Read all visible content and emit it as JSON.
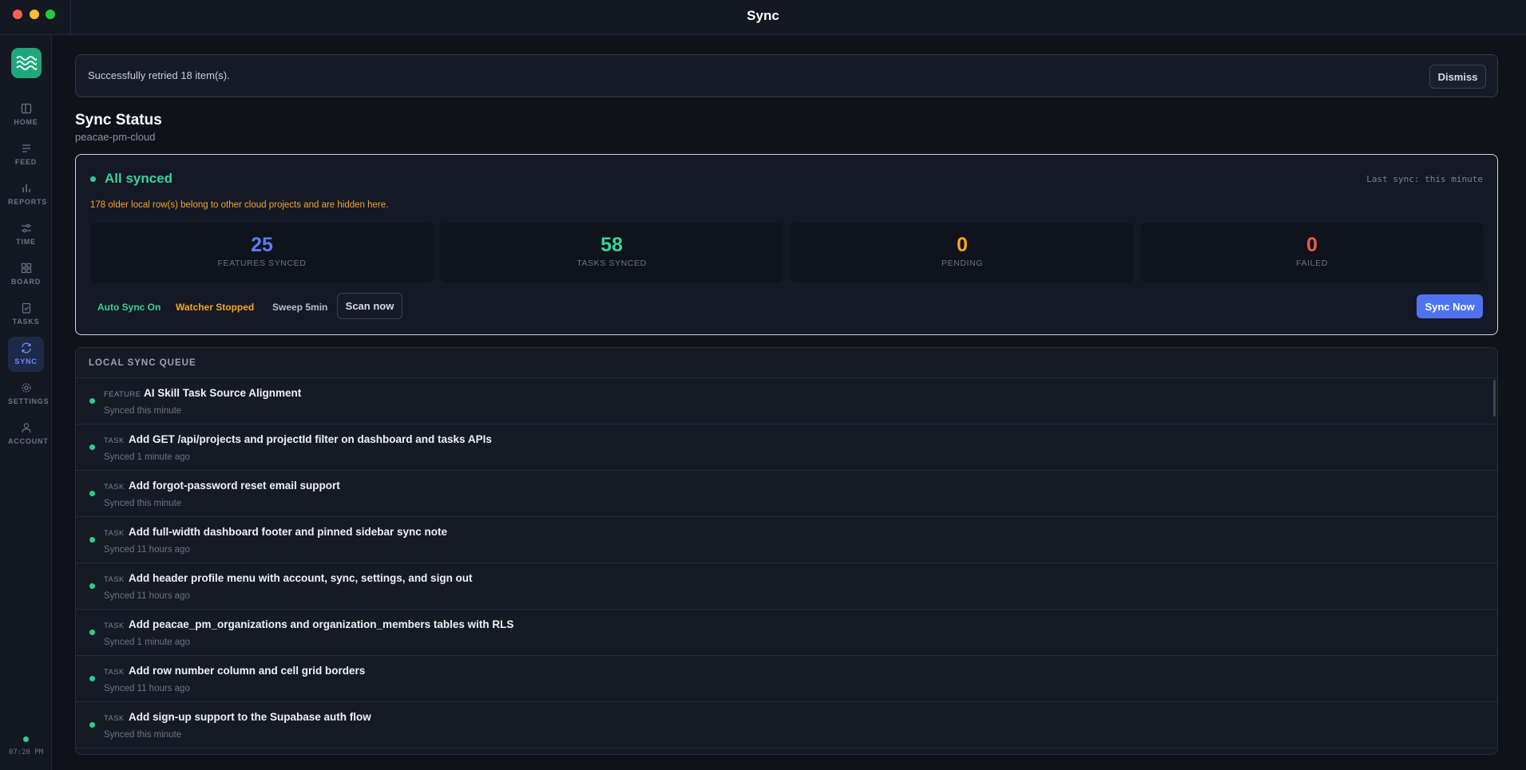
{
  "window": {
    "title": "Sync"
  },
  "sidebar": {
    "items": [
      {
        "label": "HOME",
        "icon": "home-icon"
      },
      {
        "label": "FEED",
        "icon": "feed-icon"
      },
      {
        "label": "REPORTS",
        "icon": "reports-icon"
      },
      {
        "label": "TIME",
        "icon": "time-icon"
      },
      {
        "label": "BOARD",
        "icon": "board-icon"
      },
      {
        "label": "TASKS",
        "icon": "tasks-icon"
      },
      {
        "label": "SYNC",
        "icon": "sync-icon",
        "active": true
      },
      {
        "label": "SETTINGS",
        "icon": "settings-icon"
      },
      {
        "label": "ACCOUNT",
        "icon": "account-icon"
      }
    ],
    "clock": "07:20 PM"
  },
  "banner": {
    "message": "Successfully retried 18 item(s).",
    "dismiss_label": "Dismiss"
  },
  "page": {
    "title": "Sync Status",
    "project": "peacae-pm-cloud"
  },
  "status": {
    "state": "All synced",
    "last_sync": "Last sync: this minute",
    "notice": "178 older local row(s) belong to other cloud projects and are hidden here.",
    "stats": [
      {
        "value": "25",
        "label": "FEATURES SYNCED"
      },
      {
        "value": "58",
        "label": "TASKS SYNCED"
      },
      {
        "value": "0",
        "label": "PENDING"
      },
      {
        "value": "0",
        "label": "FAILED"
      }
    ],
    "auto_sync": "Auto Sync On",
    "watcher": "Watcher Stopped",
    "sweep": "Sweep 5min",
    "scan_label": "Scan now",
    "sync_label": "Sync Now"
  },
  "queue": {
    "title": "LOCAL SYNC QUEUE",
    "items": [
      {
        "type": "FEATURE",
        "title": "AI Skill Task Source Alignment",
        "status": "Synced this minute"
      },
      {
        "type": "TASK",
        "title": "Add GET /api/projects and projectId filter on dashboard and tasks APIs",
        "status": "Synced 1 minute ago"
      },
      {
        "type": "TASK",
        "title": "Add forgot-password reset email support",
        "status": "Synced this minute"
      },
      {
        "type": "TASK",
        "title": "Add full-width dashboard footer and pinned sidebar sync note",
        "status": "Synced 11 hours ago"
      },
      {
        "type": "TASK",
        "title": "Add header profile menu with account, sync, settings, and sign out",
        "status": "Synced 11 hours ago"
      },
      {
        "type": "TASK",
        "title": "Add peacae_pm_organizations and organization_members tables with RLS",
        "status": "Synced 1 minute ago"
      },
      {
        "type": "TASK",
        "title": "Add row number column and cell grid borders",
        "status": "Synced 11 hours ago"
      },
      {
        "type": "TASK",
        "title": "Add sign-up support to the Supabase auth flow",
        "status": "Synced this minute"
      }
    ]
  },
  "colors": {
    "accent": "#4f73f0",
    "success": "#34d39b",
    "warning": "#f5a524",
    "danger": "#f0594e",
    "features": "#5b7cf5"
  }
}
